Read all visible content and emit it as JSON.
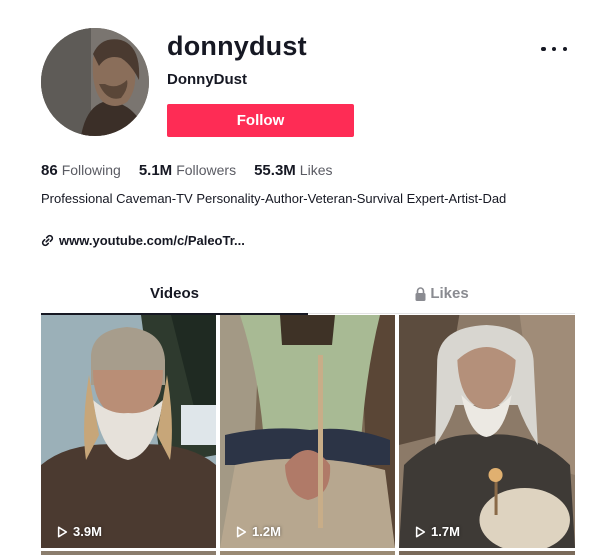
{
  "profile": {
    "username": "donnydust",
    "nickname": "DonnyDust",
    "follow_label": "Follow",
    "bio": "Professional Caveman-TV Personality-Author-Veteran-Survival Expert-Artist-Dad",
    "link_text": "www.youtube.com/c/PaleoTr...",
    "accent_color": "#fe2c55"
  },
  "stats": [
    {
      "value": "86",
      "label": "Following"
    },
    {
      "value": "5.1M",
      "label": "Followers"
    },
    {
      "value": "55.3M",
      "label": "Likes"
    }
  ],
  "tabs": {
    "videos": "Videos",
    "likes": "Likes"
  },
  "videos": [
    {
      "views": "3.9M"
    },
    {
      "views": "1.2M"
    },
    {
      "views": "1.7M"
    }
  ],
  "icons": {
    "more": "more-options-icon",
    "link": "link-icon",
    "lock": "lock-icon",
    "play": "play-icon"
  }
}
